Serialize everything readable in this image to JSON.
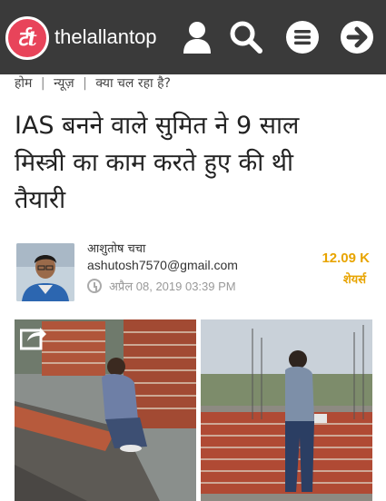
{
  "header": {
    "logo_text": "र्टt",
    "site_name": "thelallantop",
    "icons": [
      "user-icon",
      "search-icon",
      "menu-icon",
      "arrow-right-icon"
    ],
    "background": "#3a3a3a",
    "logo_color": "#e8445a"
  },
  "breadcrumb": {
    "items": [
      "होम",
      "न्यूज़",
      "क्या चल रहा है?"
    ]
  },
  "article": {
    "headline_lines": [
      "IAS बनने वाले सुमित ने 9 साल",
      "मिस्त्री का काम करते हुए की थी",
      "तैयारी"
    ]
  },
  "author": {
    "name": "आशुतोष चचा",
    "email": "ashutosh7570@gmail.com",
    "date": "अप्रैल 08, 2019 03:39 PM"
  },
  "shares": {
    "count": "12.09 K",
    "label": "शेयर्स",
    "color": "#e8a400"
  },
  "photo": {
    "share_icon": "share-icon"
  }
}
